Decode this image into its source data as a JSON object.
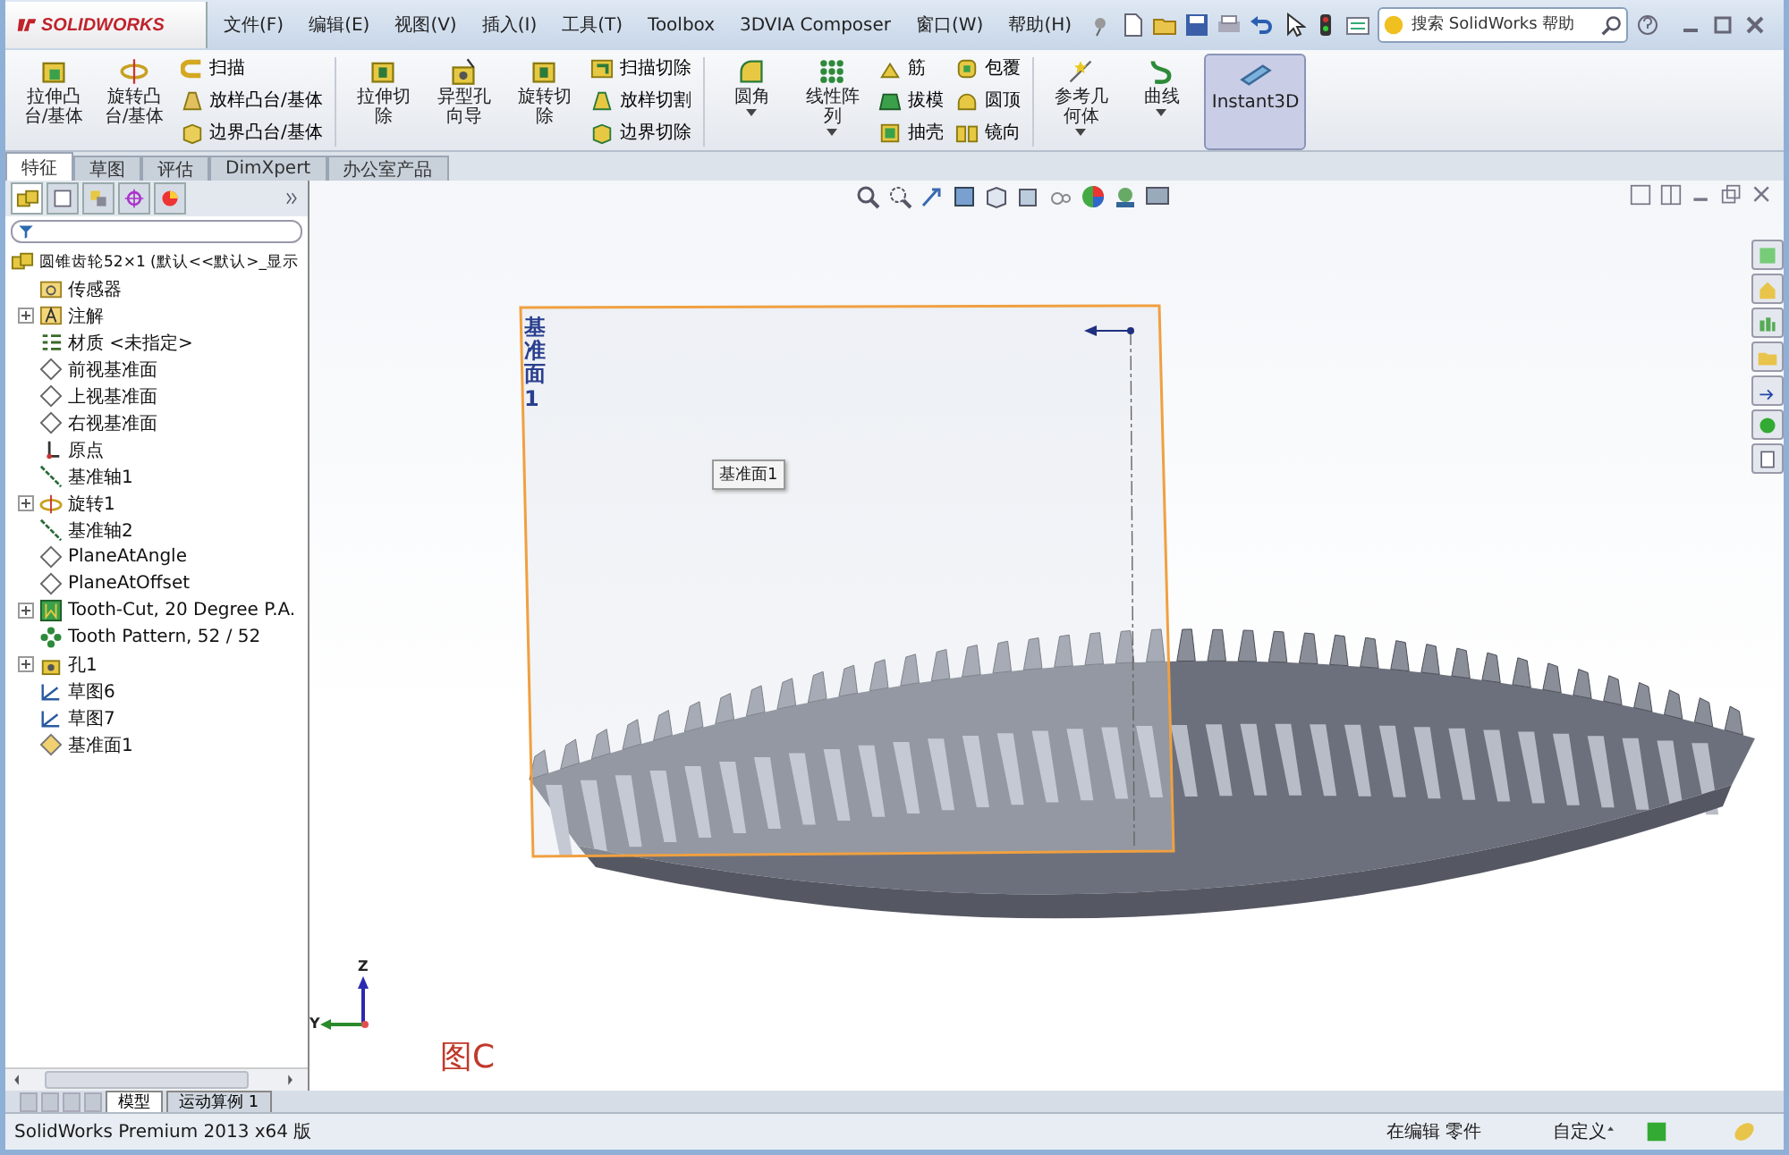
{
  "title_bar": {
    "logo": "SOLIDWORKS",
    "menus": [
      "文件(F)",
      "编辑(E)",
      "视图(V)",
      "插入(I)",
      "工具(T)",
      "Toolbox",
      "3DVIA Composer",
      "窗口(W)",
      "帮助(H)"
    ],
    "search": {
      "placeholder": "搜索 SolidWorks 帮助"
    }
  },
  "ribbon": [
    {
      "kind": "big",
      "label": "拉伸凸台/基体",
      "dropdown": false
    },
    {
      "kind": "big",
      "label": "旋转凸台/基体",
      "dropdown": false
    },
    {
      "kind": "stack",
      "items": [
        {
          "label": "扫描"
        },
        {
          "label": "放样凸台/基体"
        },
        {
          "label": "边界凸台/基体"
        }
      ]
    },
    {
      "kind": "sep"
    },
    {
      "kind": "big",
      "label": "拉伸切除",
      "dropdown": false
    },
    {
      "kind": "big",
      "label": "异型孔向导",
      "dropdown": false
    },
    {
      "kind": "big",
      "label": "旋转切除",
      "dropdown": false
    },
    {
      "kind": "stack",
      "items": [
        {
          "label": "扫描切除"
        },
        {
          "label": "放样切割"
        },
        {
          "label": "边界切除"
        }
      ]
    },
    {
      "kind": "sep"
    },
    {
      "kind": "big",
      "label": "圆角",
      "dropdown": true
    },
    {
      "kind": "big",
      "label": "线性阵列",
      "dropdown": true
    },
    {
      "kind": "stack",
      "items": [
        {
          "label": "筋"
        },
        {
          "label": "拔模"
        },
        {
          "label": "抽壳"
        }
      ]
    },
    {
      "kind": "stack",
      "items": [
        {
          "label": "包覆"
        },
        {
          "label": "圆顶"
        },
        {
          "label": "镜向"
        }
      ]
    },
    {
      "kind": "sep"
    },
    {
      "kind": "big",
      "label": "参考几何体",
      "dropdown": true
    },
    {
      "kind": "big",
      "label": "曲线",
      "dropdown": true
    },
    {
      "kind": "toggle",
      "label": "Instant3D",
      "selected": true
    }
  ],
  "command_tabs": [
    {
      "label": "特征",
      "selected": true
    },
    {
      "label": "草图",
      "selected": false
    },
    {
      "label": "评估",
      "selected": false
    },
    {
      "label": "DimXpert",
      "selected": false
    },
    {
      "label": "办公室产品",
      "selected": false
    }
  ],
  "feature_tree": {
    "root": {
      "label": "圆锥齿轮52×1  (默认<<默认>_显示",
      "kind": "part"
    },
    "items": [
      {
        "label": "传感器",
        "kind": "sensor",
        "collapsible": false
      },
      {
        "label": "注解",
        "kind": "annotation",
        "collapsible": true
      },
      {
        "label": "材质 <未指定>",
        "kind": "material",
        "collapsible": false
      },
      {
        "label": "前视基准面",
        "kind": "plane",
        "collapsible": false
      },
      {
        "label": "上视基准面",
        "kind": "plane",
        "collapsible": false
      },
      {
        "label": "右视基准面",
        "kind": "plane",
        "collapsible": false
      },
      {
        "label": "原点",
        "kind": "origin",
        "collapsible": false
      },
      {
        "label": "基准轴1",
        "kind": "axis",
        "collapsible": false
      },
      {
        "label": "旋转1",
        "kind": "revolve",
        "collapsible": true
      },
      {
        "label": "基准轴2",
        "kind": "axis",
        "collapsible": false
      },
      {
        "label": "PlaneAtAngle",
        "kind": "plane",
        "collapsible": false
      },
      {
        "label": "PlaneAtOffset",
        "kind": "plane",
        "collapsible": false
      },
      {
        "label": "Tooth-Cut, 20 Degree P.A.",
        "kind": "cut",
        "collapsible": true
      },
      {
        "label": "Tooth Pattern, 52 / 52",
        "kind": "pattern",
        "collapsible": false
      },
      {
        "label": "孔1",
        "kind": "hole",
        "collapsible": true
      },
      {
        "label": "草图6",
        "kind": "sketch",
        "collapsible": false
      },
      {
        "label": "草图7",
        "kind": "sketch",
        "collapsible": false
      },
      {
        "label": "基准面1",
        "kind": "plane-selected",
        "collapsible": false
      }
    ]
  },
  "viewport": {
    "plane_label": "基准面1",
    "tooltip": "基准面1",
    "triad": {
      "z": "Z",
      "y": "Y"
    },
    "caption": "图C"
  },
  "bottom_tabs": [
    {
      "label": "模型",
      "selected": true
    },
    {
      "label": "运动算例 1",
      "selected": false
    }
  ],
  "status_bar": {
    "product": "SolidWorks Premium 2013 x64 版",
    "mode": "在编辑 零件",
    "units": "自定义"
  }
}
